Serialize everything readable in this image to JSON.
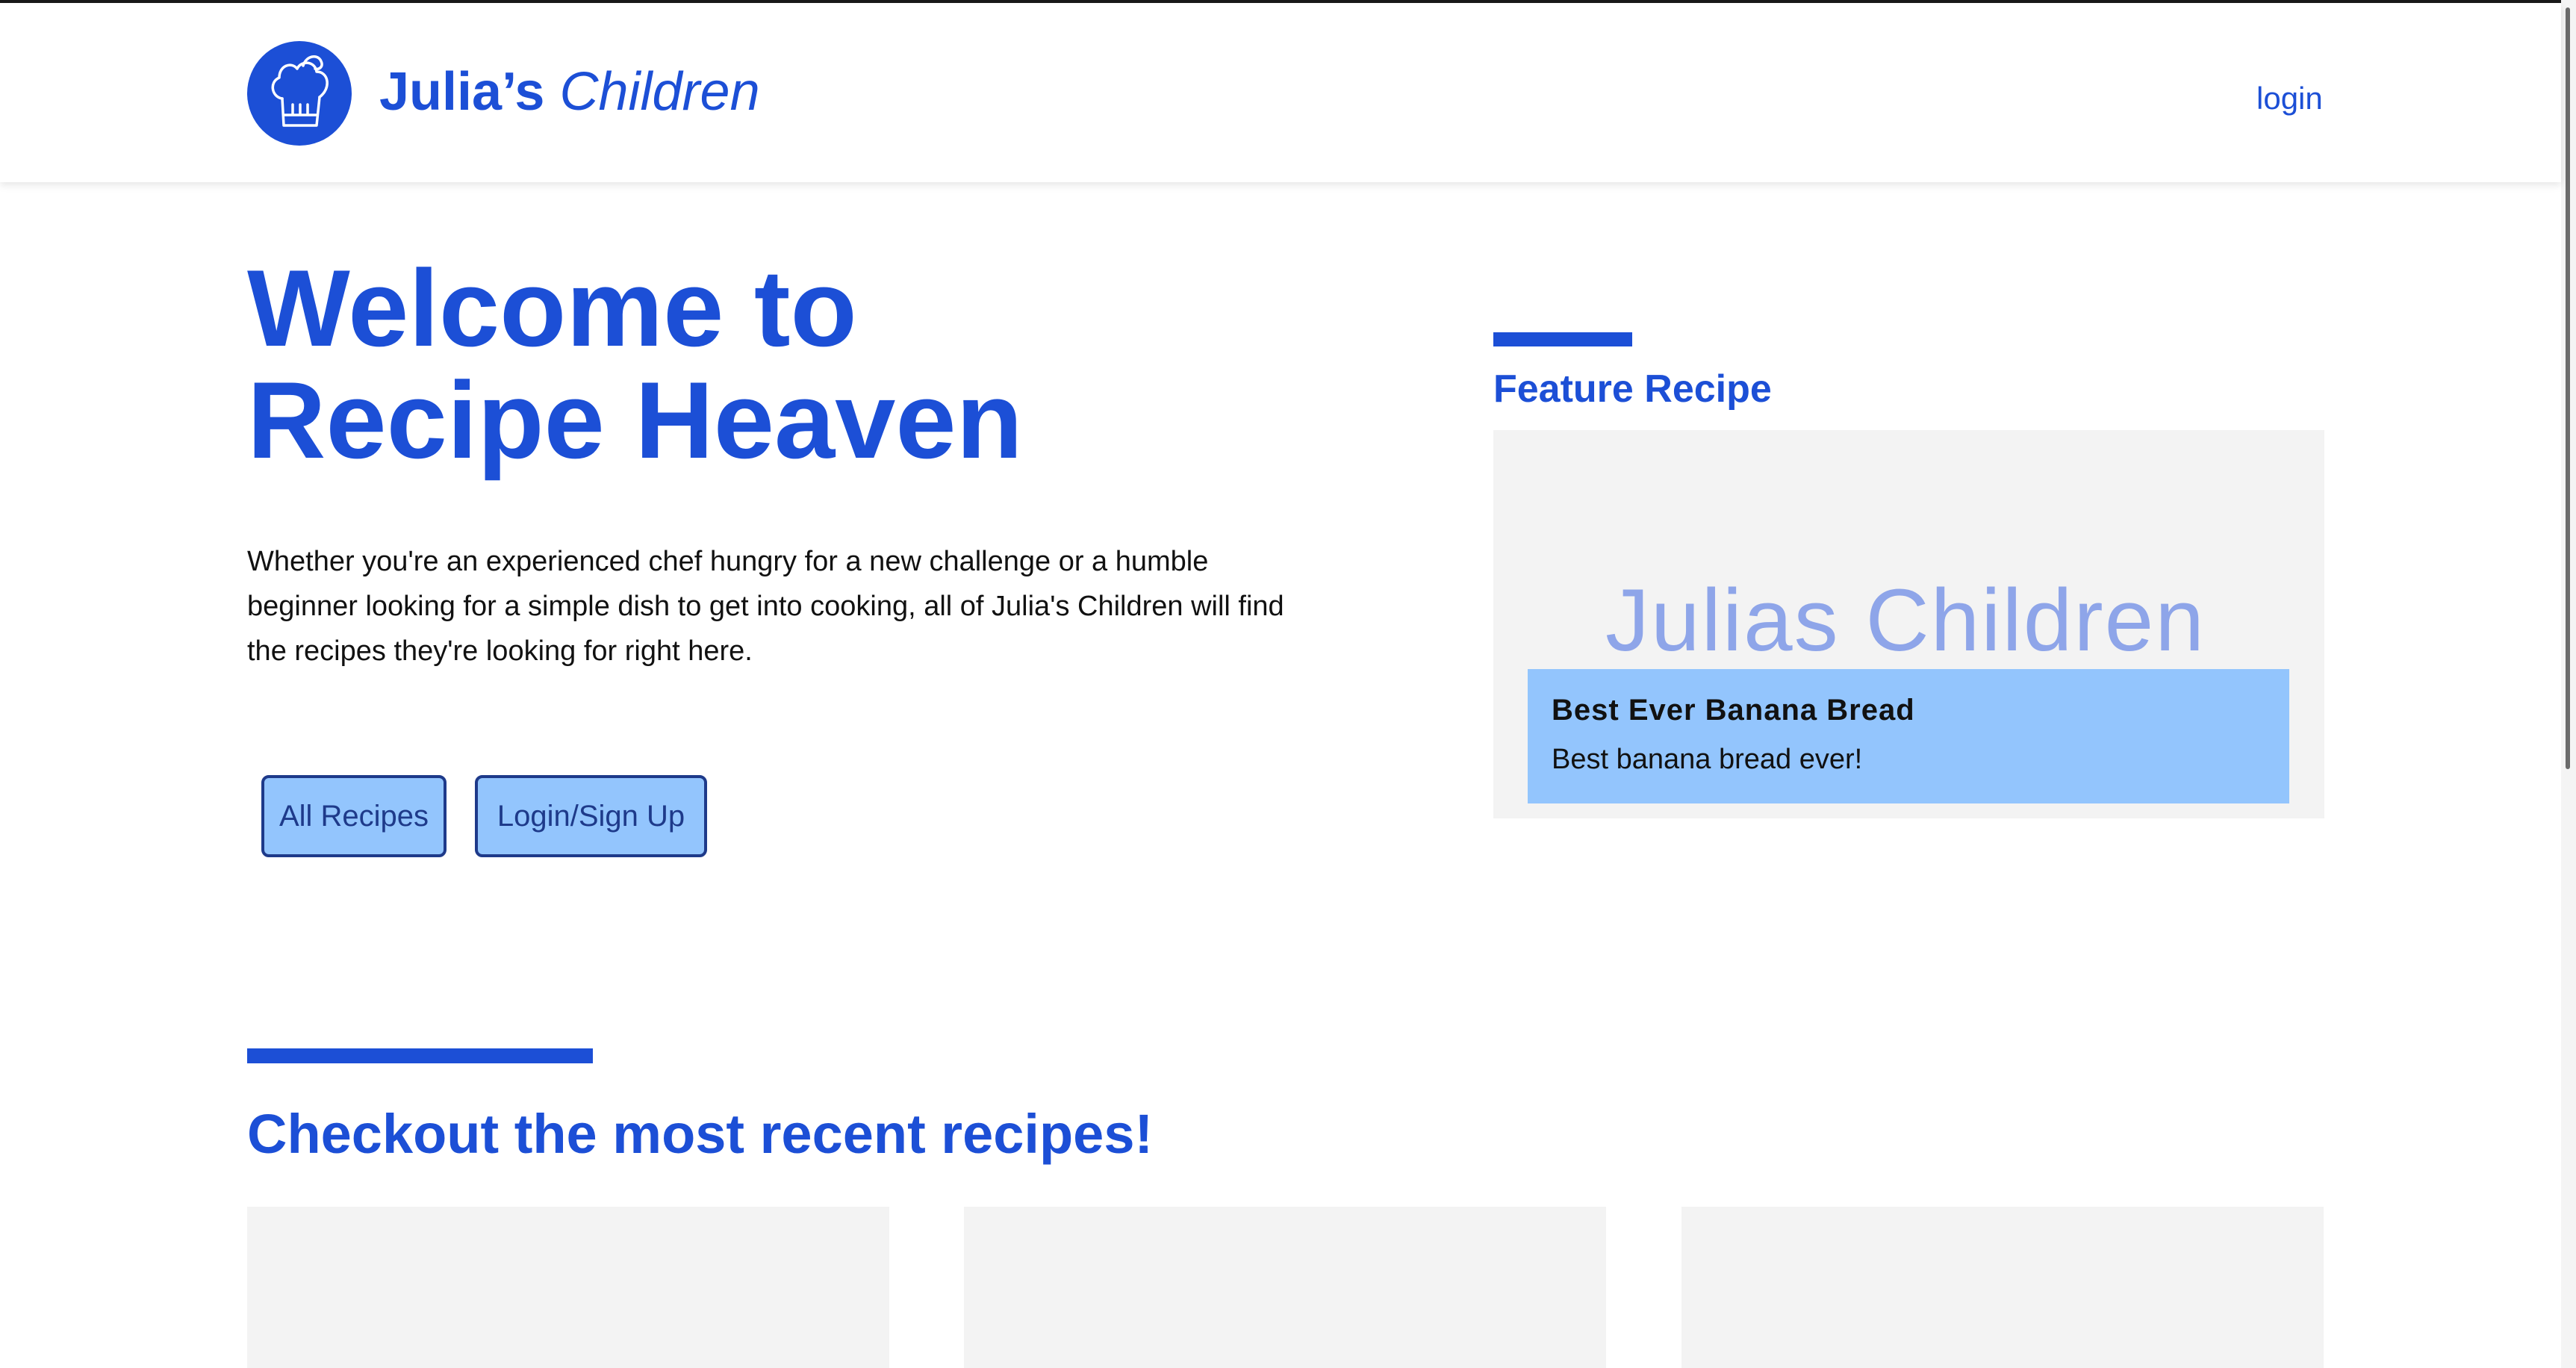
{
  "header": {
    "brand_bold": "Julia’s",
    "brand_italic": "Children",
    "logo_icon": "chef-hat-icon",
    "login_label": "login"
  },
  "hero": {
    "title": "Welcome to Recipe Heaven",
    "description": "Whether you're an experienced chef hungry for a new challenge or a humble beginner looking for a simple dish to get into cooking, all of Julia's Children will find the recipes they're looking for right here.",
    "buttons": {
      "all_recipes": "All Recipes",
      "login_signup": "Login/Sign Up"
    }
  },
  "feature": {
    "heading": "Feature Recipe",
    "image_text": "Julias Children",
    "recipe_title": "Best Ever Banana Bread",
    "recipe_description": "Best banana bread ever!"
  },
  "recent": {
    "heading": "Checkout the most recent recipes!"
  },
  "colors": {
    "accent": "#1c4fd6",
    "button_bg": "#93c5fd",
    "button_border": "#1e3a8a",
    "card_bg": "#f3f3f3"
  }
}
